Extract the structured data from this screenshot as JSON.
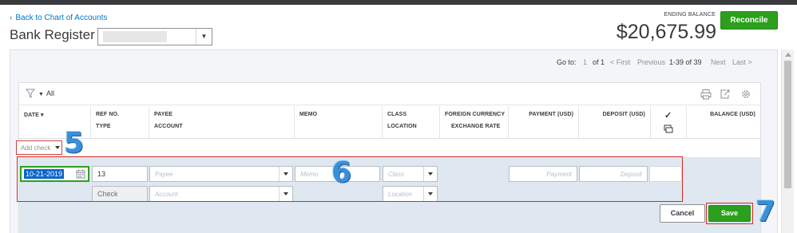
{
  "header": {
    "back_link": "Back to Chart of Accounts",
    "title": "Bank Register",
    "account_select_value": "",
    "ending_balance_label": "ENDING BALANCE",
    "ending_balance_value": "$20,675.99",
    "reconcile_label": "Reconcile"
  },
  "pagination": {
    "goto_label": "Go to:",
    "page_value": "1",
    "of_label": "of 1",
    "first": "< First",
    "previous": "Previous",
    "range": "1-39 of 39",
    "next": "Next",
    "last": "Last >"
  },
  "filter": {
    "label": "All"
  },
  "columns": {
    "date": "DATE",
    "ref_no": "REF NO.",
    "type": "TYPE",
    "payee": "PAYEE",
    "account": "ACCOUNT",
    "memo": "MEMO",
    "class": "CLASS",
    "location": "LOCATION",
    "foreign_currency": "FOREIGN CURRENCY",
    "exchange_rate": "EXCHANGE RATE",
    "payment": "PAYMENT (USD)",
    "deposit": "DEPOSIT (USD)",
    "balance": "BALANCE (USD)"
  },
  "add_check": {
    "label": "Add check"
  },
  "edit_row": {
    "date_value": "10-21-2019",
    "ref_no_value": "13",
    "type_value": "Check",
    "payee_placeholder": "Payee",
    "account_placeholder": "Account",
    "memo_placeholder": "Memo",
    "class_placeholder": "Class",
    "location_placeholder": "Location",
    "payment_placeholder": "Payment",
    "deposit_placeholder": "Deposit"
  },
  "actions": {
    "cancel_label": "Cancel",
    "save_label": "Save"
  },
  "annotations": {
    "step_5": "5",
    "step_6": "6",
    "step_7": "7"
  },
  "colors": {
    "primary_green": "#2ca01c",
    "link_blue": "#0077c5",
    "highlight_red": "#d52b1e",
    "edit_row_bg": "#dfe7f1",
    "step_number_blue": "#3a8fd8"
  }
}
